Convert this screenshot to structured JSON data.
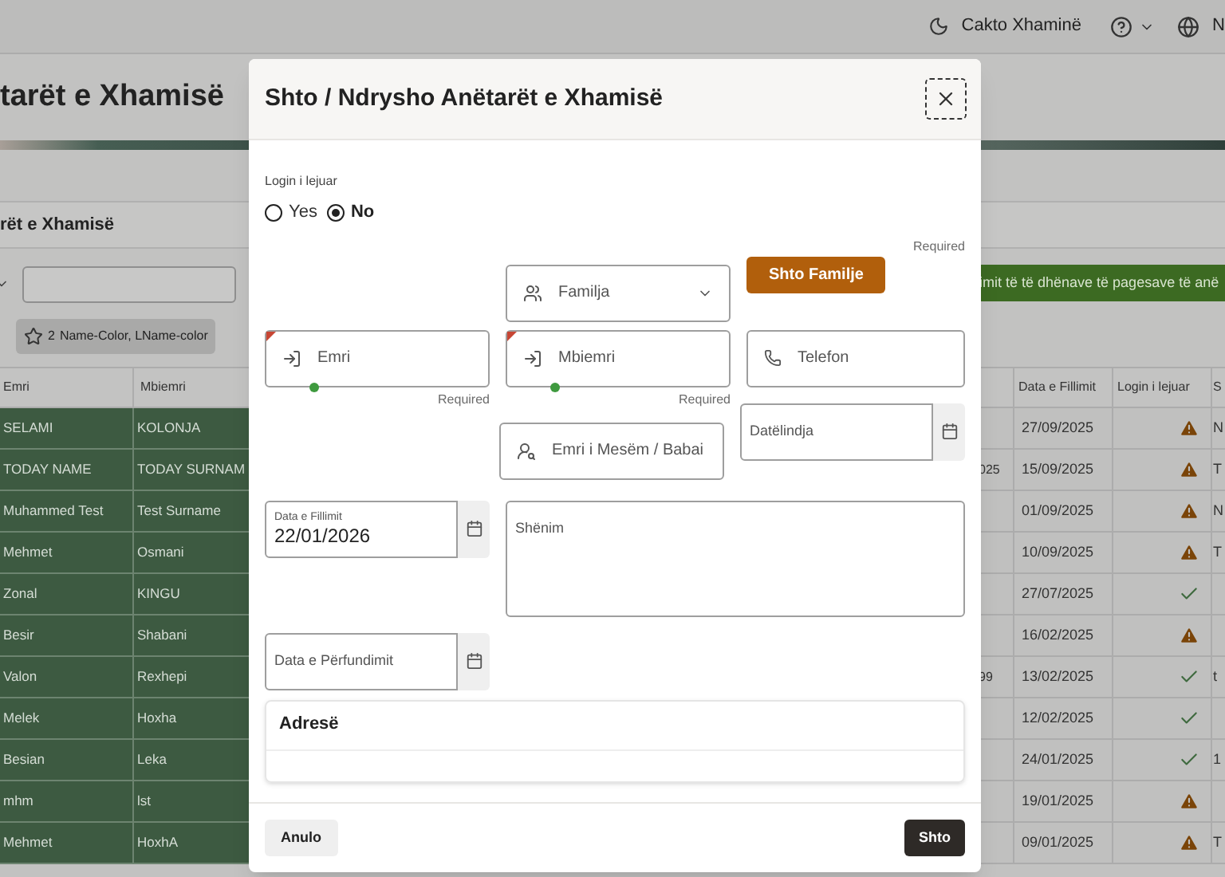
{
  "top_bar": {
    "mosque_label": "Cakto Xhaminë",
    "language_label": "N"
  },
  "page_title": "tarët e Xhamisë",
  "region_title": "rët e Xhamisë",
  "message_bar": "imit të të dhënave të pagesave të anë",
  "chip": {
    "count": "2",
    "text": "Name-Color, LName-color"
  },
  "table": {
    "columns": [
      "Emri",
      "Mbiemri",
      "Data e Fillimit",
      "Login i lejuar",
      "S"
    ],
    "rows": [
      {
        "emri": "SELAMI",
        "mbiemri": "KOLONJA",
        "column_3": "",
        "data_e_fillimit": "27/09/2025",
        "login_allowed": false,
        "column_6": "N"
      },
      {
        "emri": "TODAY NAME",
        "mbiemri": "TODAY SURNAM",
        "column_3": "025",
        "data_e_fillimit": "15/09/2025",
        "login_allowed": false,
        "column_6": "T"
      },
      {
        "emri": "Muhammed Test",
        "mbiemri": "Test Surname",
        "column_3": "",
        "data_e_fillimit": "01/09/2025",
        "login_allowed": false,
        "column_6": "N"
      },
      {
        "emri": "Mehmet",
        "mbiemri": "Osmani",
        "column_3": "",
        "data_e_fillimit": "10/09/2025",
        "login_allowed": false,
        "column_6": "T"
      },
      {
        "emri": "Zonal",
        "mbiemri": "KINGU",
        "column_3": "",
        "data_e_fillimit": "27/07/2025",
        "login_allowed": true,
        "column_6": ""
      },
      {
        "emri": "Besir",
        "mbiemri": "Shabani",
        "column_3": "",
        "data_e_fillimit": "16/02/2025",
        "login_allowed": false,
        "column_6": ""
      },
      {
        "emri": "Valon",
        "mbiemri": "Rexhepi",
        "column_3": "99",
        "data_e_fillimit": "13/02/2025",
        "login_allowed": true,
        "column_6": "t"
      },
      {
        "emri": "Melek",
        "mbiemri": "Hoxha",
        "column_3": "",
        "data_e_fillimit": "12/02/2025",
        "login_allowed": true,
        "column_6": ""
      },
      {
        "emri": "Besian",
        "mbiemri": "Leka",
        "column_3": "",
        "data_e_fillimit": "24/01/2025",
        "login_allowed": true,
        "column_6": "1"
      },
      {
        "emri": "mhm",
        "mbiemri": "lst",
        "column_3": "",
        "data_e_fillimit": "19/01/2025",
        "login_allowed": false,
        "column_6": ""
      },
      {
        "emri": "Mehmet",
        "mbiemri": "HoxhA",
        "column_3": "",
        "data_e_fillimit": "09/01/2025",
        "login_allowed": false,
        "column_6": "T"
      }
    ]
  },
  "dialog": {
    "title": "Shto / Ndrysho Anëtarët e Xhamisë",
    "login_field": {
      "label": "Login i lejuar",
      "options": [
        {
          "label": "Yes",
          "selected": false
        },
        {
          "label": "No",
          "selected": true
        }
      ]
    },
    "required_note": "Required",
    "familja": {
      "placeholder": "Familja"
    },
    "add_family_button": "Shto Familje",
    "emri": {
      "placeholder": "Emri",
      "required": true,
      "required_text": "Required"
    },
    "mbiemri": {
      "placeholder": "Mbiemri",
      "required": true,
      "required_text": "Required"
    },
    "telefon": {
      "placeholder": "Telefon"
    },
    "emri_mesem": {
      "placeholder": "Emri i Mesëm / Babai"
    },
    "datelindja": {
      "placeholder": "Datëlindja"
    },
    "data_e_fillimit": {
      "label": "Data e Fillimit",
      "value": "22/01/2026"
    },
    "shenim": {
      "placeholder": "Shënim"
    },
    "data_e_perfundimit": {
      "placeholder": "Data e Përfundimit"
    },
    "address_title": "Adresë",
    "cancel_button": "Anulo",
    "submit_button": "Shto"
  }
}
